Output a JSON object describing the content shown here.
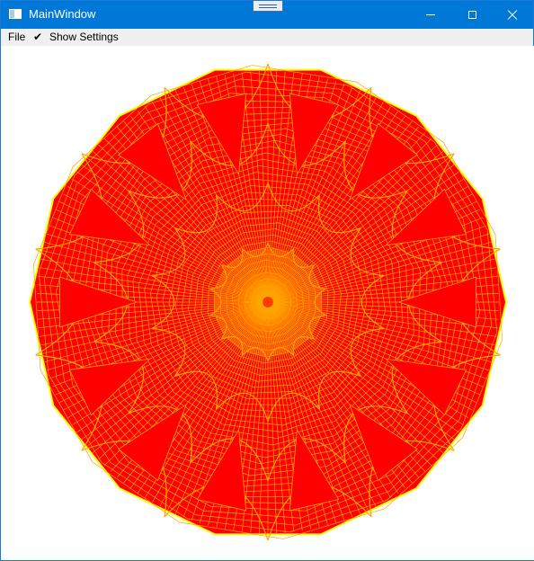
{
  "window": {
    "title": "MainWindow"
  },
  "titlebar": {
    "icon": "window-app-icon",
    "grip": "drag-grip-icon",
    "controls": [
      "minimize-icon",
      "maximize-icon",
      "close-icon"
    ]
  },
  "menu": {
    "file_label": "File",
    "settings_check": "✔",
    "settings_label": "Show Settings",
    "settings_checked": true
  },
  "canvas": {
    "description_colors": {
      "fill": "#ff0000",
      "line": "#ffa500",
      "edge": "#ffff00",
      "background": "#ffffff"
    },
    "polygon_sides": 14
  },
  "colors": {
    "titlebar": "#0078d7",
    "menubar": "#f0f0f0",
    "accent_red": "#ff0000",
    "accent_orange": "#ffa500",
    "accent_yellow": "#ffff00"
  }
}
